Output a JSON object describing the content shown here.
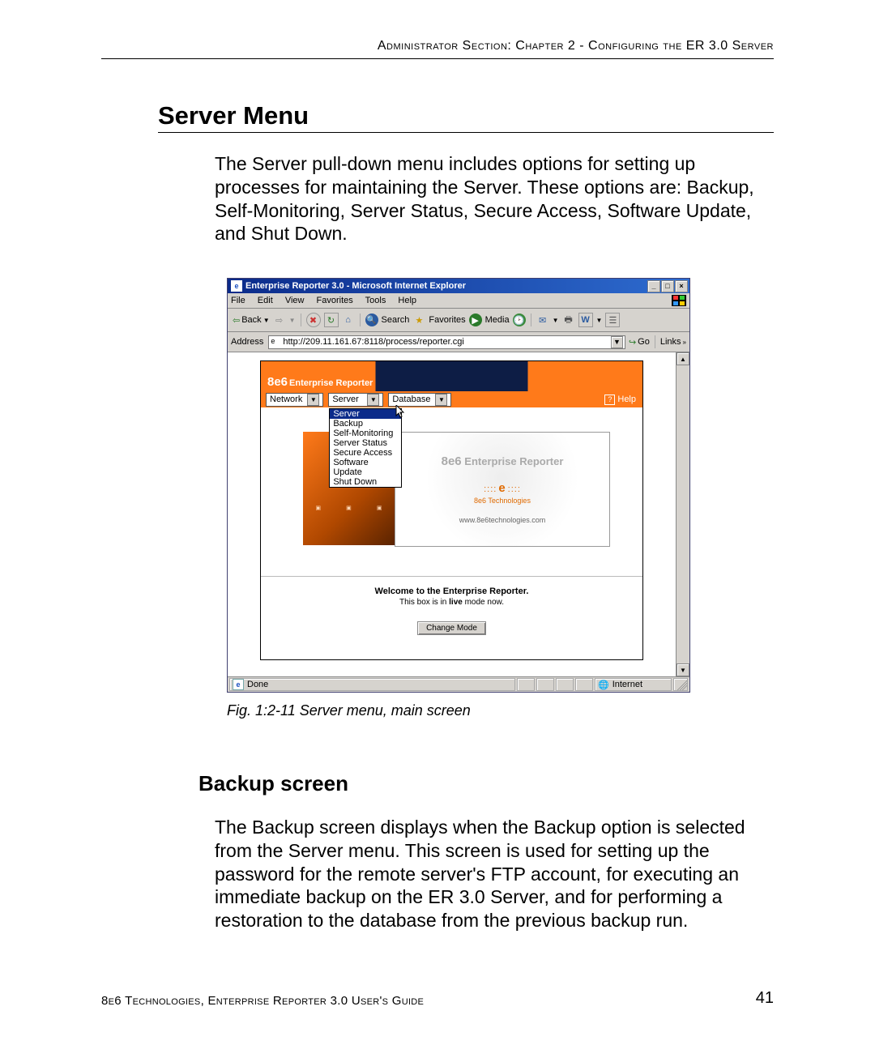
{
  "header": {
    "running_head": "Administrator Section: Chapter 2 - Configuring the ER 3.0 Server"
  },
  "section": {
    "title": "Server Menu",
    "para1": "The Server pull-down menu includes options for setting up processes for maintaining the Server. These options are: Backup, Self-Monitoring, Server Status, Secure Access, Software Update, and Shut Down."
  },
  "figure": {
    "caption": "Fig. 1:2-11  Server menu, main screen"
  },
  "subsection": {
    "title": "Backup screen",
    "para1": "The Backup screen displays when the Backup option is selected from the Server menu. This screen is used for setting up the password for the remote server's FTP account, for executing an immediate backup on the ER 3.0 Server, and for performing a restoration to the database from the previous backup run."
  },
  "footer": {
    "left": "8e6 Technologies, Enterprise Reporter 3.0 User's Guide",
    "page": "41"
  },
  "screenshot": {
    "titlebar": "Enterprise Reporter 3.0 - Microsoft Internet Explorer",
    "menubar": {
      "file": "File",
      "edit": "Edit",
      "view": "View",
      "favorites": "Favorites",
      "tools": "Tools",
      "help": "Help"
    },
    "toolbar": {
      "back": "Back",
      "search": "Search",
      "favorites": "Favorites",
      "media": "Media"
    },
    "address": {
      "label": "Address",
      "url": "http://209.11.161.67:8118/process/reporter.cgi",
      "go": "Go",
      "links": "Links"
    },
    "app": {
      "brand_bold": "8e6",
      "brand_rest": "Enterprise Reporter",
      "menu_network": "Network",
      "menu_server": "Server",
      "menu_database": "Database",
      "help": "Help",
      "dropdown": [
        "Server",
        "Backup",
        "Self-Monitoring",
        "Server Status",
        "Secure Access",
        "Software Update",
        "Shut Down"
      ],
      "right_wm_bold": "8e6",
      "right_wm_rest": "Enterprise Reporter",
      "right_tech": "8e6 Technologies",
      "right_url": "www.8e6technologies.com",
      "welcome": "Welcome to the Enterprise Reporter.",
      "mode_pre": "This box is in ",
      "mode_bold": "live",
      "mode_post": " mode now.",
      "change_mode": "Change Mode"
    },
    "status": {
      "done": "Done",
      "zone": "Internet"
    }
  }
}
